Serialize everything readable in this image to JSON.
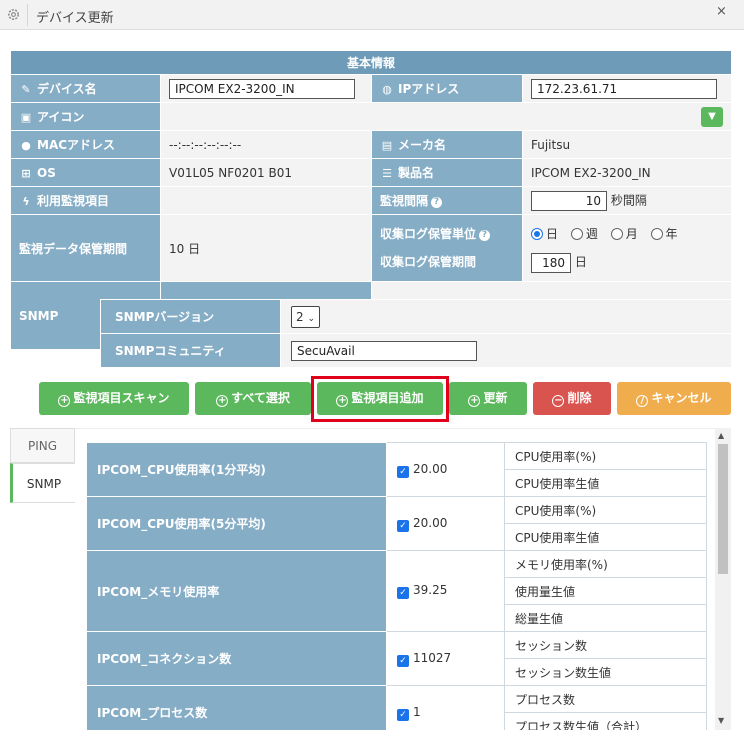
{
  "window": {
    "title": "デバイス更新",
    "close_label": "×"
  },
  "basic_info": {
    "header": "基本情報",
    "device_name_label": "デバイス名",
    "device_name_value": "IPCOM EX2-3200_IN",
    "ip_label": "IPアドレス",
    "ip_value": "172.23.61.71",
    "icon_label": "アイコン",
    "mac_label": "MACアドレス",
    "mac_value": "--:--:--:--:--:--",
    "maker_label": "メーカ名",
    "maker_value": "Fujitsu",
    "os_label": "OS",
    "os_value": "V01L05 NF0201 B01",
    "product_label": "製品名",
    "product_value": "IPCOM EX2-3200_IN",
    "monitor_items_label": "利用監視項目",
    "interval_label": "監視間隔",
    "interval_value": "10",
    "interval_unit": "秒間隔",
    "retention_label": "監視データ保管期間",
    "retention_value": "10 日",
    "log_unit_label": "収集ログ保管単位",
    "log_units": [
      "日",
      "週",
      "月",
      "年"
    ],
    "log_unit_selected": "日",
    "log_period_label": "収集ログ保管期間",
    "log_period_value": "180",
    "log_period_unit": "日"
  },
  "snmp": {
    "label": "SNMP",
    "version_label": "SNMPバージョン",
    "version_value": "2",
    "community_label": "SNMPコミュニティ",
    "community_value": "SecuAvail"
  },
  "buttons": {
    "scan": "監視項目スキャン",
    "select_all": "すべて選択",
    "add_item": "監視項目追加",
    "update": "更新",
    "delete": "削除",
    "cancel": "キャンセル"
  },
  "tabs": [
    "PING",
    "SNMP"
  ],
  "active_tab": "SNMP",
  "metrics": [
    {
      "name": "IPCOM_CPU使用率(1分平均)",
      "value": "20.00",
      "checked": true,
      "subs": [
        "CPU使用率(%)",
        "CPU使用率生値"
      ]
    },
    {
      "name": "IPCOM_CPU使用率(5分平均)",
      "value": "20.00",
      "checked": true,
      "subs": [
        "CPU使用率(%)",
        "CPU使用率生値"
      ]
    },
    {
      "name": "IPCOM_メモリ使用率",
      "value": "39.25",
      "checked": true,
      "subs": [
        "メモリ使用率(%)",
        "使用量生値",
        "総量生値"
      ]
    },
    {
      "name": "IPCOM_コネクション数",
      "value": "11027",
      "checked": true,
      "subs": [
        "セッション数",
        "セッション数生値"
      ]
    },
    {
      "name": "IPCOM_プロセス数",
      "value": "1",
      "checked": true,
      "subs": [
        "プロセス数",
        "プロセス数生値（合計）"
      ]
    }
  ],
  "colors": {
    "header": "#6e9cb8",
    "label": "#86adc6",
    "green": "#5cb85c",
    "red": "#d9534f",
    "orange": "#f0ad4e",
    "highlight": "#e0001b"
  }
}
